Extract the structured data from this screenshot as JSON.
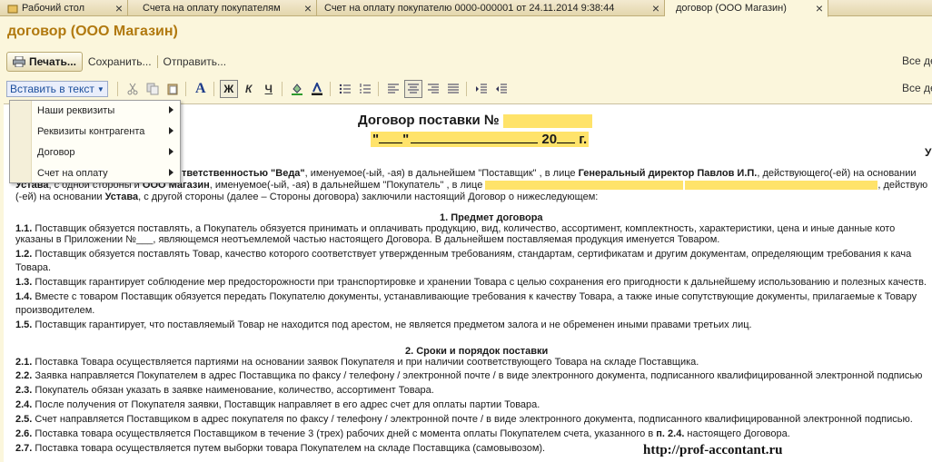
{
  "tabs": [
    {
      "label": "Рабочий стол",
      "active": false
    },
    {
      "label": "Счета на оплату покупателям",
      "active": false
    },
    {
      "label": "Счет на оплату покупателю 0000-000001 от 24.11.2014 9:38:44",
      "active": false
    },
    {
      "label": "договор (ООО Магазин)",
      "active": true
    }
  ],
  "title": "договор (ООО Магазин)",
  "toolbar": {
    "print_label": "Печать...",
    "save_label": "Сохранить...",
    "send_label": "Отправить...",
    "all_actions_label": "Все де"
  },
  "format_toolbar": {
    "insert_label": "Вставить в текст",
    "all_actions_label": "Все де",
    "italic_letter": "К",
    "underline_letter": "Ч",
    "bold_letter": "Ж",
    "font_letter": "A"
  },
  "insert_menu": {
    "items": [
      "Наши реквизиты",
      "Реквизиты контрагента",
      "Договор",
      "Счет на оплату"
    ]
  },
  "document": {
    "heading": "Договор поставки №",
    "date_line_quote_open": "\"",
    "date_line_quote_close": "\"",
    "date_line_year": "20",
    "date_line_g": "г.",
    "right_cut": "Уф",
    "line1_a": "тветственностью ",
    "line1_veda": "\"Веда\"",
    "line1_b": ", именуемое(-ый, -ая) в дальнейшем \"Поставщик\" , в лице ",
    "line1_dir": "Генеральный директор Павлов И.П.",
    "line1_c": ", действующего(-ей) на основании",
    "line2_a": "Устава",
    "line2_b": ", с одной стороны и ",
    "line2_magazin": "ООО Магазин",
    "line2_c": ", именуемое(-ый, -ая) в дальнейшем \"Покупатель\" , в лице",
    "line2_d": ", действую",
    "line3_a": "(-ей) на основании ",
    "line3_ustava": "Устава",
    "line3_b": ",  с другой стороны (далее – Стороны договора) заключили настоящий Договор о нижеследующем:",
    "section1": "1. Предмет договора",
    "p1_1_num": "1.1.",
    "p1_1": " Поставщик обязуется поставлять, а Покупатель обязуется принимать и оплачивать продукцию, вид, количество, ассортимент, комплектность, характеристики, цена и иные данные кото",
    "p1_1b": "указаны в Приложении №___, являющемся неотъемлемой частью настоящего Договора. В дальнейшем поставляемая продукция именуется Товаром.",
    "p1_2_num": "1.2.",
    "p1_2": " Поставщик обязуется поставлять Товар, качество которого соответствует утвержденным требованиям, стандартам, сертификатам и другим документам, определяющим требования к кача",
    "p1_2b": "Товара.",
    "p1_3_num": "1.3.",
    "p1_3": " Поставщик гарантирует соблюдение мер предосторожности при транспортировке и хранении Товара с целью сохранения его пригодности к дальнейшему использованию и полезных качеств.",
    "p1_4_num": "1.4.",
    "p1_4": " Вместе с товаром Поставщик обязуется передать Покупателю документы, устанавливающие требования к качеству Товара, а также иные сопутствующие документы, прилагаемые к Товару",
    "p1_4b": "производителем.",
    "p1_5_num": "1.5.",
    "p1_5": " Поставщик гарантирует, что поставляемый Товар не находится под арестом, не является предметом залога и не обременен иными правами третьих лиц.",
    "section2": "2. Сроки и порядок поставки",
    "p2_1_num": "2.1.",
    "p2_1": " Поставка Товара осуществляется партиями на основании заявок Покупателя и при наличии соответствующего Товара на складе Поставщика.",
    "p2_2_num": "2.2.",
    "p2_2": " Заявка направляется Покупателем в адрес Поставщика по факсу / телефону / электронной почте / в виде электронного документа, подписанного квалифицированной электронной подписью",
    "p2_3_num": "2.3.",
    "p2_3": " Покупатель обязан указать в заявке наименование, количество, ассортимент Товара.",
    "p2_4_num": "2.4.",
    "p2_4": " После получения от Покупателя заявки, Поставщик направляет в его адрес счет для оплаты партии Товара.",
    "p2_5_num": "2.5.",
    "p2_5": " Счет направляется Поставщиком в адрес покупателя по факсу / телефону / электронной почте / в виде электронного документа, подписанного квалифицированной электронной подписью.",
    "p2_6_num": "2.6.",
    "p2_6a": " Поставка товара осуществляется Поставщиком в течение 3 (трех) рабочих дней с момента оплаты Покупателем счета, указанного в ",
    "p2_6ref": "п. 2.4.",
    "p2_6b": " настоящего Договора.",
    "p2_7_num": "2.7.",
    "p2_7": " Поставка товара осуществляется путем выборки товара Покупателем на складе Поставщика (самовывозом)."
  },
  "watermark": "http://prof-accontant.ru",
  "colors": {
    "title": "#b1790f",
    "highlight": "#ffe36a",
    "background": "#fbf6dc"
  }
}
